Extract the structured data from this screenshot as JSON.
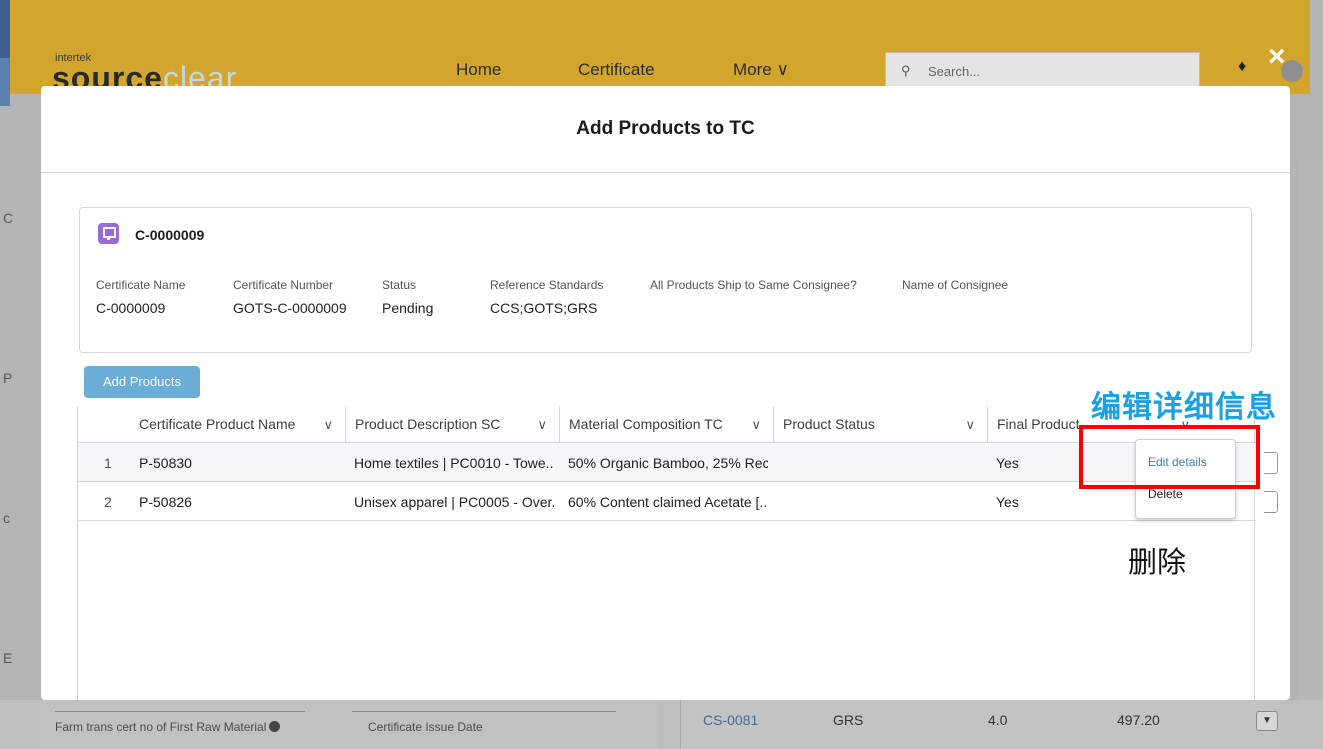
{
  "app": {
    "logo_small": "intertek",
    "logo_main_dark": "source",
    "logo_main_light": "clear",
    "nav": [
      "Home",
      "Certificate",
      "More ∨"
    ],
    "search_placeholder": "Search...",
    "close_icon": "×"
  },
  "modal": {
    "title": "Add Products to TC",
    "certificate": {
      "id": "C-0000009",
      "fields": [
        {
          "label": "Certificate Name",
          "value": "C-0000009"
        },
        {
          "label": "Certificate Number",
          "value": "GOTS-C-0000009"
        },
        {
          "label": "Status",
          "value": "Pending"
        },
        {
          "label": "Reference Standards",
          "value": "CCS;GOTS;GRS"
        },
        {
          "label": "All Products Ship to Same Consignee?",
          "value": ""
        },
        {
          "label": "Name of Consignee",
          "value": ""
        }
      ]
    },
    "add_products_label": "Add Products",
    "table": {
      "columns": [
        "Certificate Product Name",
        "Product Description SC",
        "Material Composition TC",
        "Product Status",
        "Final Product"
      ],
      "rows": [
        {
          "num": "1",
          "name": "P-50830",
          "desc": "Home textiles | PC0010 - Towe...",
          "material": "50% Organic Bamboo, 25% Rec...",
          "status": "",
          "final": "Yes"
        },
        {
          "num": "2",
          "name": "P-50826",
          "desc": "Unisex apparel | PC0005 - Over...",
          "material": "60% Content claimed Acetate [...",
          "status": "",
          "final": "Yes"
        }
      ]
    },
    "row_menu": {
      "edit": "Edit details",
      "delete": "Delete"
    }
  },
  "annotations": {
    "edit_label": "编辑详细信息",
    "delete_label": "删除",
    "highlight_color": "#ff0000",
    "blue_color": "#1ba1e2"
  },
  "background": {
    "fields": [
      "Farm trans cert no of First Raw Material",
      "Certificate Issue Date"
    ],
    "row": {
      "id": "CS-0081",
      "standard": "GRS",
      "version": "4.0",
      "value": "497.20"
    }
  }
}
